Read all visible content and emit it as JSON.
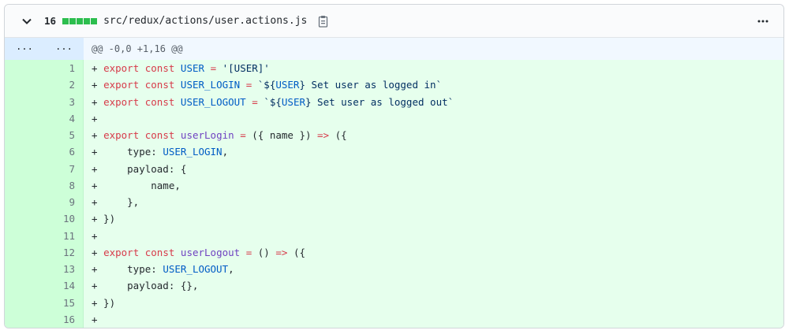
{
  "header": {
    "changes_count": "16",
    "file_path": "src/redux/actions/user.actions.js"
  },
  "hunk": {
    "old_marker": "...",
    "new_marker": "...",
    "header_text": "@@ -0,0 +1,16 @@"
  },
  "lines": [
    {
      "num": "1",
      "tokens": [
        [
          "+ ",
          ""
        ],
        [
          "export",
          "kw"
        ],
        [
          " ",
          ""
        ],
        [
          "const",
          "kw"
        ],
        [
          " ",
          ""
        ],
        [
          "USER",
          "cn"
        ],
        [
          " ",
          ""
        ],
        [
          "=",
          "kw"
        ],
        [
          " ",
          ""
        ],
        [
          "'[USER]'",
          "st"
        ]
      ]
    },
    {
      "num": "2",
      "tokens": [
        [
          "+ ",
          ""
        ],
        [
          "export",
          "kw"
        ],
        [
          " ",
          ""
        ],
        [
          "const",
          "kw"
        ],
        [
          " ",
          ""
        ],
        [
          "USER_LOGIN",
          "cn"
        ],
        [
          " ",
          ""
        ],
        [
          "=",
          "kw"
        ],
        [
          " ",
          ""
        ],
        [
          "`${",
          "st"
        ],
        [
          "USER",
          "cn"
        ],
        [
          "} Set user as logged in`",
          "st"
        ]
      ]
    },
    {
      "num": "3",
      "tokens": [
        [
          "+ ",
          ""
        ],
        [
          "export",
          "kw"
        ],
        [
          " ",
          ""
        ],
        [
          "const",
          "kw"
        ],
        [
          " ",
          ""
        ],
        [
          "USER_LOGOUT",
          "cn"
        ],
        [
          " ",
          ""
        ],
        [
          "=",
          "kw"
        ],
        [
          " ",
          ""
        ],
        [
          "`${",
          "st"
        ],
        [
          "USER",
          "cn"
        ],
        [
          "} Set user as logged out`",
          "st"
        ]
      ]
    },
    {
      "num": "4",
      "tokens": [
        [
          "+",
          ""
        ]
      ]
    },
    {
      "num": "5",
      "tokens": [
        [
          "+ ",
          ""
        ],
        [
          "export",
          "kw"
        ],
        [
          " ",
          ""
        ],
        [
          "const",
          "kw"
        ],
        [
          " ",
          ""
        ],
        [
          "userLogin",
          "fn"
        ],
        [
          " ",
          ""
        ],
        [
          "=",
          "kw"
        ],
        [
          " ({ name }) ",
          ""
        ],
        [
          "=>",
          "kw"
        ],
        [
          " ({",
          ""
        ]
      ]
    },
    {
      "num": "6",
      "tokens": [
        [
          "+     type: ",
          ""
        ],
        [
          "USER_LOGIN",
          "cn"
        ],
        [
          ",",
          ""
        ]
      ]
    },
    {
      "num": "7",
      "tokens": [
        [
          "+     payload: {",
          ""
        ]
      ]
    },
    {
      "num": "8",
      "tokens": [
        [
          "+         name,",
          ""
        ]
      ]
    },
    {
      "num": "9",
      "tokens": [
        [
          "+     },",
          ""
        ]
      ]
    },
    {
      "num": "10",
      "tokens": [
        [
          "+ })",
          ""
        ]
      ]
    },
    {
      "num": "11",
      "tokens": [
        [
          "+",
          ""
        ]
      ]
    },
    {
      "num": "12",
      "tokens": [
        [
          "+ ",
          ""
        ],
        [
          "export",
          "kw"
        ],
        [
          " ",
          ""
        ],
        [
          "const",
          "kw"
        ],
        [
          " ",
          ""
        ],
        [
          "userLogout",
          "fn"
        ],
        [
          " ",
          ""
        ],
        [
          "=",
          "kw"
        ],
        [
          " () ",
          ""
        ],
        [
          "=>",
          "kw"
        ],
        [
          " ({",
          ""
        ]
      ]
    },
    {
      "num": "13",
      "tokens": [
        [
          "+     type: ",
          ""
        ],
        [
          "USER_LOGOUT",
          "cn"
        ],
        [
          ",",
          ""
        ]
      ]
    },
    {
      "num": "14",
      "tokens": [
        [
          "+     payload: {},",
          ""
        ]
      ]
    },
    {
      "num": "15",
      "tokens": [
        [
          "+ })",
          ""
        ]
      ]
    },
    {
      "num": "16",
      "tokens": [
        [
          "+",
          ""
        ]
      ]
    }
  ]
}
